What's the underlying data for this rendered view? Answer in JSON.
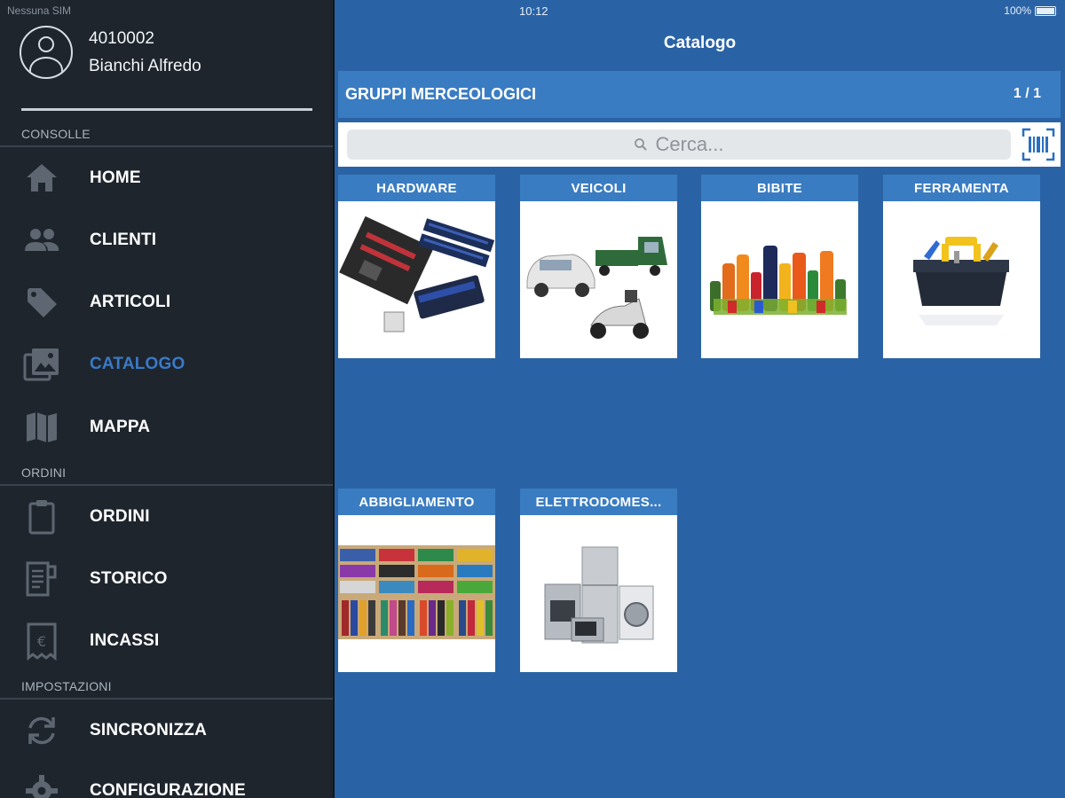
{
  "status_bar": {
    "carrier": "Nessuna SIM",
    "time": "10:12",
    "battery": "100%"
  },
  "profile": {
    "code": "4010002",
    "name": "Bianchi Alfredo"
  },
  "sections": {
    "consolle": "CONSOLLE",
    "ordini": "ORDINI",
    "impostazioni": "IMPOSTAZIONI"
  },
  "nav": {
    "home": "HOME",
    "clienti": "CLIENTI",
    "articoli": "ARTICOLI",
    "catalogo": "CATALOGO",
    "mappa": "MAPPA",
    "ordini": "ORDINI",
    "storico": "STORICO",
    "incassi": "INCASSI",
    "sincronizza": "SINCRONIZZA",
    "configurazione": "CONFIGURAZIONE"
  },
  "colors": {
    "sidebar_bg": "#1e252d",
    "main_bg": "#2a63a5",
    "header_blue": "#3a7cc1",
    "active_text": "#3a7ac8"
  },
  "main": {
    "title": "Catalogo",
    "group_title": "GRUPPI MERCEOLOGICI",
    "page_indicator": "1 / 1",
    "search_placeholder": "Cerca...",
    "tiles": [
      {
        "label": "HARDWARE"
      },
      {
        "label": "VEICOLI"
      },
      {
        "label": "BIBITE"
      },
      {
        "label": "FERRAMENTA"
      },
      {
        "label": "ABBIGLIAMENTO"
      },
      {
        "label": "ELETTRODOMES..."
      }
    ]
  }
}
